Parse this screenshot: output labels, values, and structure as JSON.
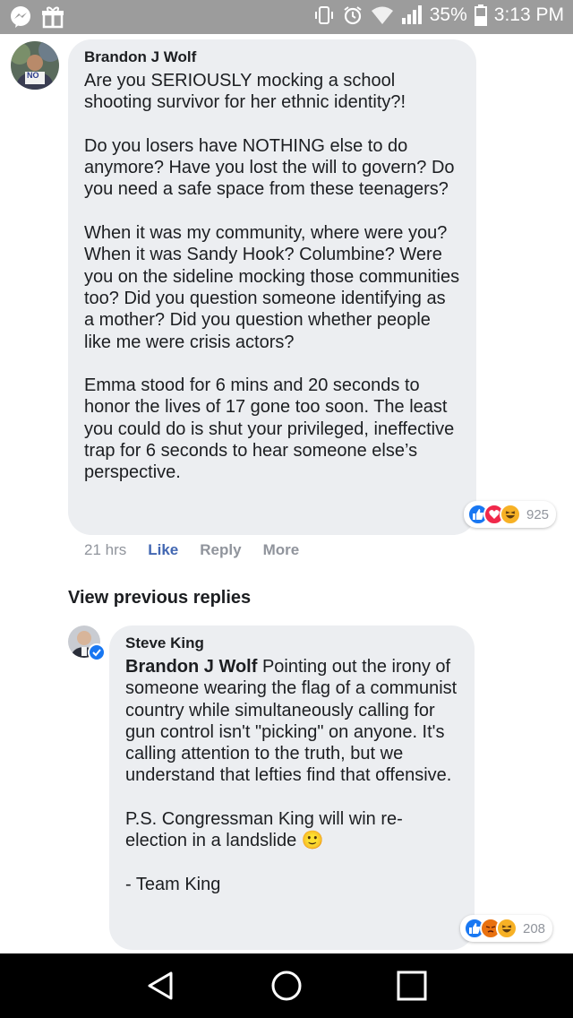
{
  "status_bar": {
    "battery": "35%",
    "time": "3:13 PM"
  },
  "comments": [
    {
      "author": "Brandon J Wolf",
      "text": "Are you SERIOUSLY mocking a school shooting survivor for her ethnic identity?!\n\nDo you losers have NOTHING else to do anymore? Have you lost the will to govern? Do you need a safe space from these teenagers?\n\nWhen it was my community, where were you? When it was Sandy Hook? Columbine? Were you on the sideline mocking those communities too? Did you question someone identifying as a mother? Did you question whether people like me were crisis actors?\n\nEmma stood for 6 mins and 20 seconds to honor the lives of 17 gone too soon. The least you could do is shut your privileged, ineffective trap for 6 seconds to hear someone else’s perspective.",
      "reaction_count": "925",
      "time": "21 hrs",
      "like_label": "Like",
      "reply_label": "Reply",
      "more_label": "More",
      "avatar_sign_text": "NO"
    }
  ],
  "view_previous_replies": "View previous replies",
  "reply": {
    "author": "Steve King",
    "mention": "Brandon J Wolf",
    "text": " Pointing out the irony of someone wearing the flag of a communist country while simultaneously calling for gun control isn't \"picking\" on anyone. It's calling attention to the truth, but we understand that lefties find that offensive.\n\nP.S. Congressman King will win re-election in a landslide ",
    "emoji": "🙂",
    "signature": "\n\n- Team King",
    "reaction_count": "208"
  },
  "icons": {
    "status_left": [
      "messenger-icon",
      "gift-icon"
    ],
    "status_right": [
      "vibrate-icon",
      "alarm-icon",
      "wifi-icon",
      "signal-icon",
      "battery-icon"
    ],
    "reactions_1": [
      "like-reaction-icon",
      "love-reaction-icon",
      "haha-reaction-icon"
    ],
    "reactions_2": [
      "like-reaction-icon",
      "angry-reaction-icon",
      "haha-reaction-icon"
    ],
    "nav": [
      "back-icon",
      "home-icon",
      "recents-icon"
    ]
  },
  "colors": {
    "status_bar": "#9c9c9c",
    "bubble": "#eceef1",
    "link_blue": "#4267b2",
    "meta_gray": "#90949c",
    "like_blue": "#1877f2",
    "love_red": "#f0284a",
    "haha_yellow": "#f7b125",
    "angry_orange": "#e9710f",
    "navbar": "#000000"
  }
}
